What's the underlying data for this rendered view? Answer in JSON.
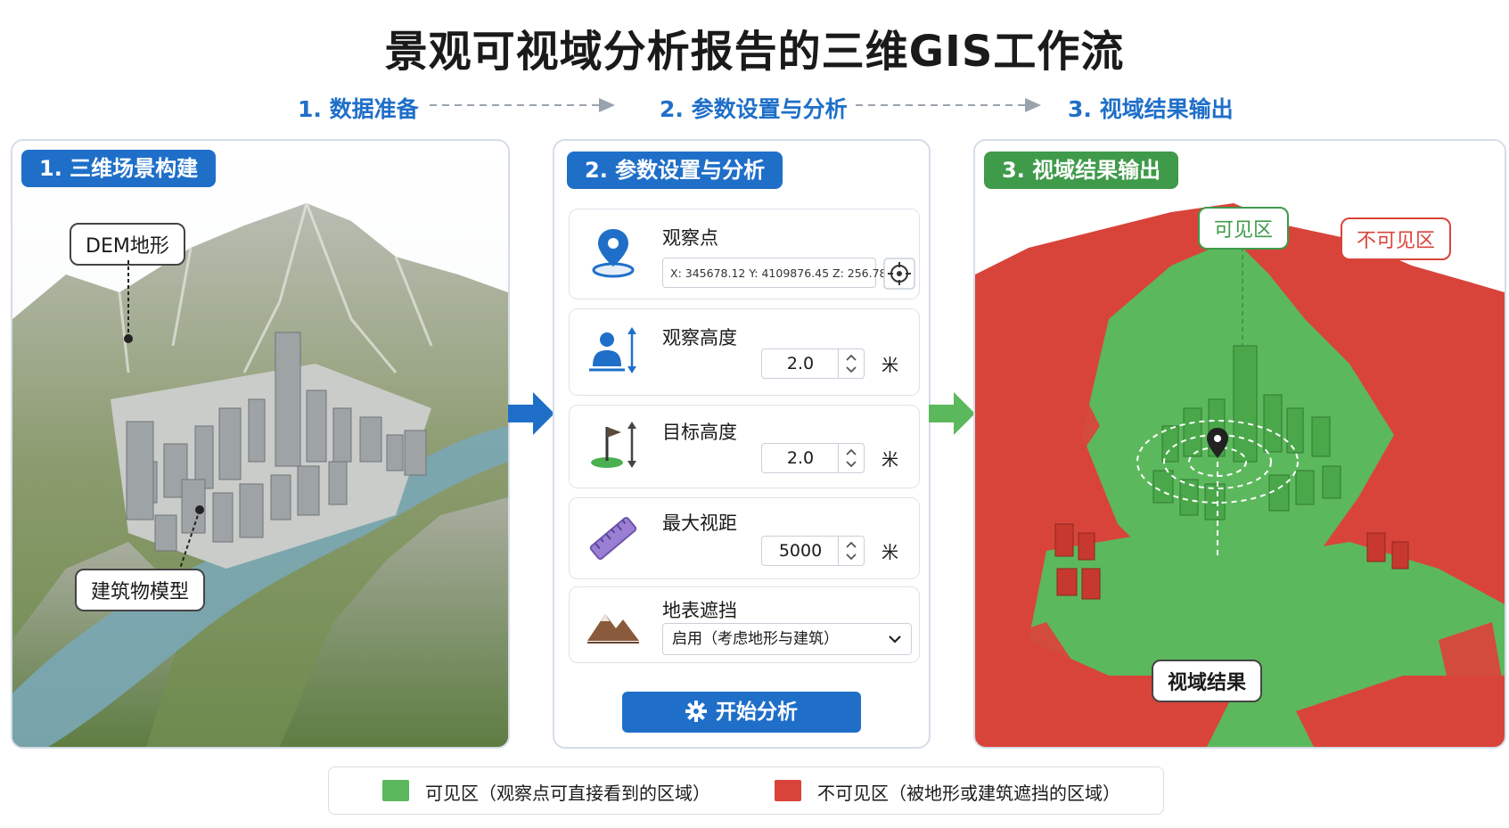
{
  "title": "景观可视域分析报告的三维GIS工作流",
  "steps": [
    "1. 数据准备",
    "2. 参数设置与分析",
    "3. 视域结果输出"
  ],
  "panel1": {
    "tag": "1. 三维场景构建",
    "callout_dem": "DEM地形",
    "callout_buildings": "建筑物模型"
  },
  "panel2": {
    "tag": "2. 参数设置与分析",
    "observer": {
      "label": "观察点",
      "coords": "X: 345678.12   Y: 4109876.45   Z: 256.78"
    },
    "observer_height": {
      "label": "观察高度",
      "value": "2.0",
      "unit": "米"
    },
    "target_height": {
      "label": "目标高度",
      "value": "2.0",
      "unit": "米"
    },
    "max_distance": {
      "label": "最大视距",
      "value": "5000",
      "unit": "米"
    },
    "surface_occlusion": {
      "label": "地表遮挡",
      "value": "启用（考虑地形与建筑）"
    },
    "start_button": "开始分析"
  },
  "panel3": {
    "tag": "3. 视域结果输出",
    "visible_callout": "可见区",
    "invisible_callout": "不可见区",
    "result_label": "视域结果"
  },
  "legend": {
    "visible": "可见区（观察点可直接看到的区域）",
    "invisible": "不可见区（被地形或建筑遮挡的区域）"
  },
  "colors": {
    "blue": "#1f6fc9",
    "green": "#3f9a4a",
    "visible": "#5cb85c",
    "invisible": "#d9443a"
  }
}
